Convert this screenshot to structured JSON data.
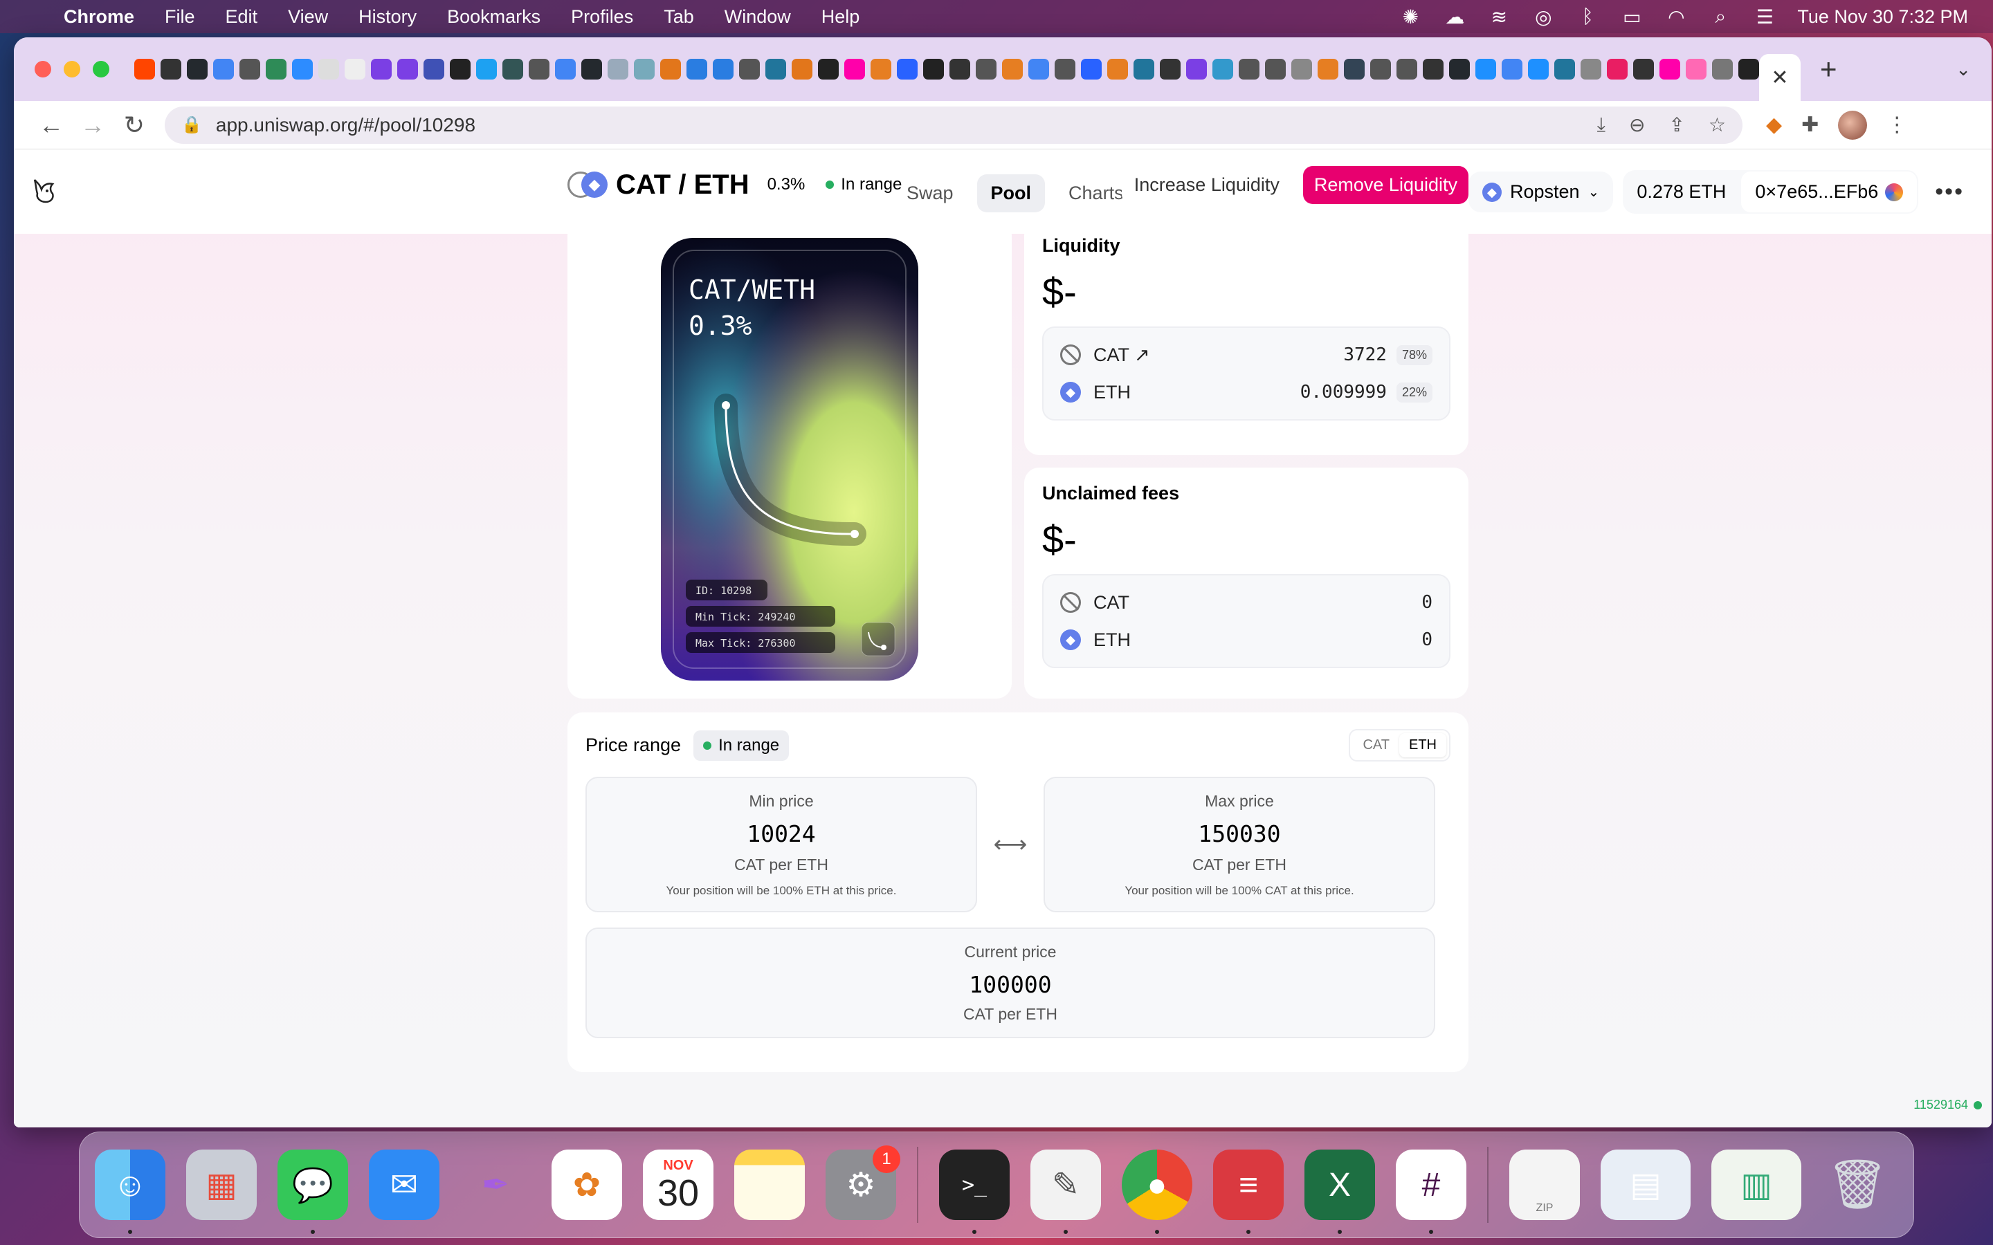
{
  "menubar": {
    "app_name": "Chrome",
    "items": [
      "File",
      "Edit",
      "View",
      "History",
      "Bookmarks",
      "Profiles",
      "Tab",
      "Window",
      "Help"
    ],
    "clock": "Tue Nov 30  7:32 PM"
  },
  "browser": {
    "url": "app.uniswap.org/#/pool/10298",
    "active_tab_close": "✕"
  },
  "app": {
    "nav": {
      "swap": "Swap",
      "pool": "Pool",
      "charts": "Charts ↗"
    },
    "network": "Ropsten",
    "balance": "0.278 ETH",
    "address": "0×7e65...EFb6",
    "more": "•••"
  },
  "position": {
    "title": "CAT / ETH",
    "fee_tier": "0.3%",
    "status": "In range",
    "increase_label": "Increase Liquidity",
    "remove_label": "Remove Liquidity",
    "nft": {
      "pair": "CAT/WETH",
      "fee": "0.3%",
      "id": "ID: 10298",
      "min_tick": "Min Tick: 249240",
      "max_tick": "Max Tick: 276300"
    },
    "liquidity": {
      "label": "Liquidity",
      "value": "$-",
      "tokens": [
        {
          "symbol": "CAT ↗",
          "amount": "3722",
          "percent": "78%"
        },
        {
          "symbol": "ETH",
          "amount": "0.009999",
          "percent": "22%"
        }
      ]
    },
    "fees": {
      "label": "Unclaimed fees",
      "value": "$-",
      "tokens": [
        {
          "symbol": "CAT",
          "amount": "0"
        },
        {
          "symbol": "ETH",
          "amount": "0"
        }
      ]
    },
    "price_range": {
      "label": "Price range",
      "status": "In range",
      "toggle": [
        "CAT",
        "ETH"
      ],
      "min": {
        "label": "Min price",
        "value": "10024",
        "unit": "CAT per ETH",
        "note": "Your position will be 100% ETH at this price."
      },
      "max": {
        "label": "Max price",
        "value": "150030",
        "unit": "CAT per ETH",
        "note": "Your position will be 100% CAT at this price."
      },
      "arrow": "⟷",
      "current": {
        "label": "Current price",
        "value": "100000",
        "unit": "CAT per ETH"
      }
    }
  },
  "block_number": "11529164",
  "dock": {
    "calendar_month": "NOV",
    "calendar_day": "30",
    "settings_badge": "1",
    "zip_label": "ZIP"
  },
  "colors": {
    "accent_pink": "#e8006f",
    "in_range_green": "#27ae60",
    "eth_blue": "#627eea"
  }
}
